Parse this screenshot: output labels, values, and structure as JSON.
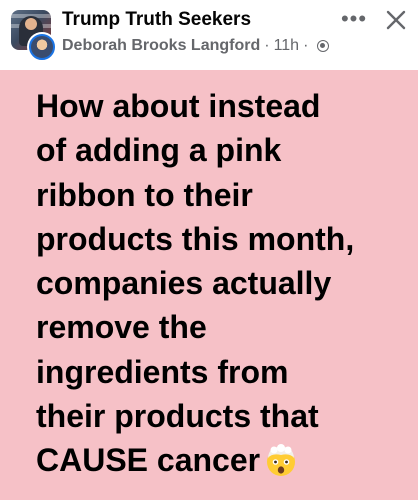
{
  "header": {
    "group_name": "Trump Truth Seekers",
    "author": "Deborah Brooks Langford",
    "separator": "·",
    "time": "11h",
    "separator2": "·",
    "privacy_icon": "globe-icon",
    "more_icon": "more-horizontal-icon",
    "more_label": "•••",
    "close_icon": "close-icon"
  },
  "post": {
    "background_color": "#f6c1c7",
    "lines": [
      "How about instead",
      "of adding a pink",
      "ribbon to their",
      "products this month,",
      "companies actually",
      "remove the",
      "ingredients from",
      "their products that",
      "CAUSE cancer"
    ],
    "emoji": "exploding-head-emoji"
  }
}
